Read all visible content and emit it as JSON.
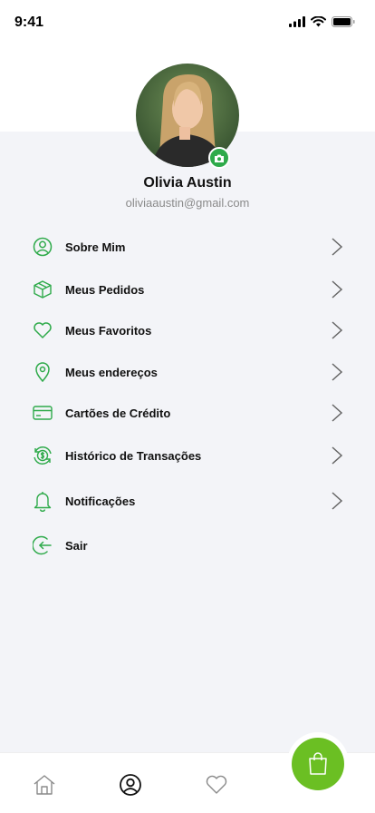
{
  "status_bar": {
    "time": "9:41"
  },
  "profile": {
    "name": "Olivia Austin",
    "email": "oliviaaustin@gmail.com"
  },
  "menu": [
    {
      "label": "Sobre Mim",
      "icon": "user-circle-icon"
    },
    {
      "label": "Meus Pedidos",
      "icon": "package-icon"
    },
    {
      "label": "Meus Favoritos",
      "icon": "heart-icon"
    },
    {
      "label": "Meus endereços",
      "icon": "map-pin-icon"
    },
    {
      "label": "Cartões de Crédito",
      "icon": "credit-card-icon"
    },
    {
      "label": "Histórico de Transações",
      "icon": "transaction-history-icon"
    },
    {
      "label": "Notificações",
      "icon": "bell-icon"
    },
    {
      "label": "Sair",
      "icon": "logout-icon"
    }
  ],
  "colors": {
    "accent": "#2eaa4a",
    "cart_button": "#6bbf23",
    "background": "#f3f4f8"
  }
}
